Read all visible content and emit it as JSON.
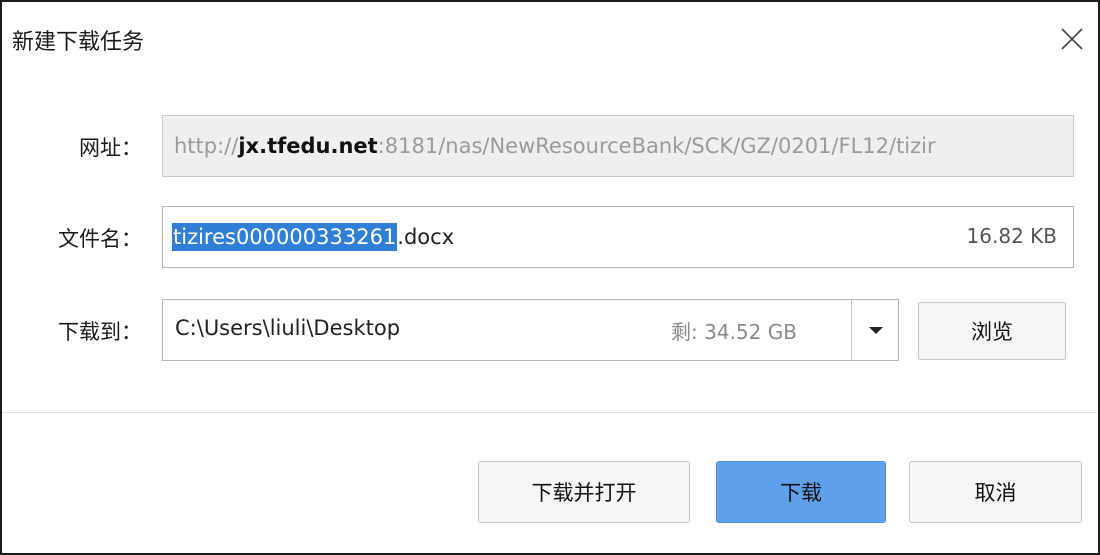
{
  "dialog": {
    "title": "新建下载任务"
  },
  "url": {
    "label": "网址：",
    "prefix": "http://",
    "host": "jx.tfedu.net",
    "rest": ":8181/nas/NewResourceBank/SCK/GZ/0201/FL12/tizir"
  },
  "filename": {
    "label": "文件名：",
    "selected_part": "tizires000000333261",
    "extension": ".docx",
    "size": "16.82 KB"
  },
  "destination": {
    "label": "下载到：",
    "path": "C:\\Users\\liuli\\Desktop",
    "free_space": "剩: 34.52 GB",
    "browse_label": "浏览"
  },
  "buttons": {
    "download_open": "下载并打开",
    "download": "下载",
    "cancel": "取消"
  },
  "icons": {
    "close": "close-icon",
    "dropdown": "chevron-down-icon"
  },
  "colors": {
    "selection": "#2f7fd6",
    "primary_button": "#5ea0ea"
  }
}
